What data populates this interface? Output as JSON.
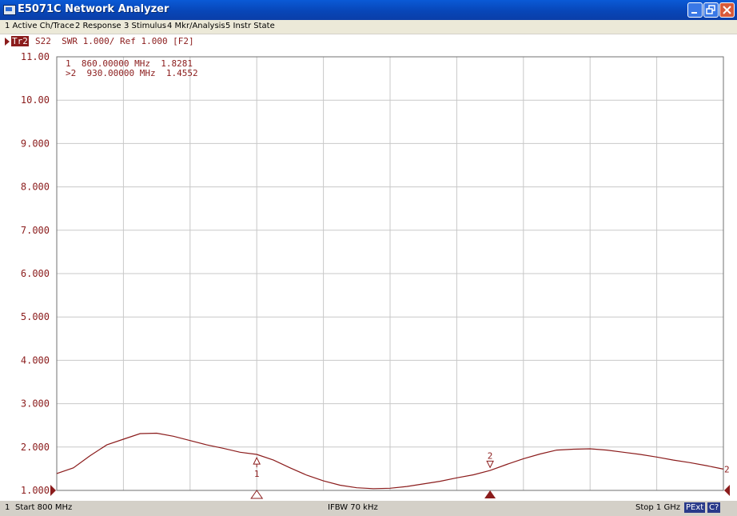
{
  "window": {
    "title": "E5071C Network Analyzer"
  },
  "menu": {
    "items": [
      {
        "label": "1 Active Ch/Trace"
      },
      {
        "label": "2 Response"
      },
      {
        "label": "3 Stimulus"
      },
      {
        "label": "4 Mkr/Analysis"
      },
      {
        "label": "5 Instr State"
      }
    ]
  },
  "trace": {
    "badge": "Tr2",
    "info": "S22  SWR 1.000/ Ref 1.000 [F2]",
    "color": "#8b1c1c"
  },
  "markers": {
    "readout": [
      {
        "text": "1  860.00000 MHz  1.8281"
      },
      {
        "text": ">2  930.00000 MHz  1.4552"
      }
    ],
    "labels": [
      "1",
      "2"
    ]
  },
  "status": {
    "channel": "1",
    "start": "Start 800 MHz",
    "ifbw": "IFBW 70 kHz",
    "stop": "Stop 1 GHz",
    "pext": "PExt",
    "cal": "C?"
  },
  "chart_data": {
    "type": "line",
    "xlabel": "",
    "ylabel": "",
    "xlim": [
      800,
      1000
    ],
    "ylim": [
      1.0,
      11.0
    ],
    "x_unit": "MHz",
    "y_ticks": [
      "1.000",
      "2.000",
      "3.000",
      "4.000",
      "5.000",
      "6.000",
      "7.000",
      "8.000",
      "9.000",
      "10.00",
      "11.00"
    ],
    "grid": true,
    "series": [
      {
        "x": [
          800,
          805,
          810,
          815,
          820,
          825,
          830,
          835,
          840,
          845,
          850,
          855,
          860,
          865,
          870,
          875,
          880,
          885,
          890,
          895,
          900,
          905,
          910,
          915,
          920,
          925,
          930,
          935,
          940,
          945,
          950,
          955,
          960,
          965,
          970,
          975,
          980,
          985,
          990,
          995,
          1000
        ],
        "values": [
          1.39,
          1.52,
          1.8,
          2.05,
          2.18,
          2.31,
          2.32,
          2.25,
          2.15,
          2.05,
          1.97,
          1.88,
          1.83,
          1.7,
          1.52,
          1.35,
          1.22,
          1.12,
          1.06,
          1.04,
          1.05,
          1.09,
          1.15,
          1.21,
          1.29,
          1.36,
          1.46,
          1.6,
          1.73,
          1.84,
          1.93,
          1.95,
          1.96,
          1.93,
          1.88,
          1.83,
          1.77,
          1.7,
          1.64,
          1.57,
          1.49
        ]
      }
    ],
    "markers": [
      {
        "label": "1",
        "x": 860.0,
        "y": 1.8281
      },
      {
        "label": "2",
        "x": 930.0,
        "y": 1.4552,
        "active": true
      }
    ]
  }
}
